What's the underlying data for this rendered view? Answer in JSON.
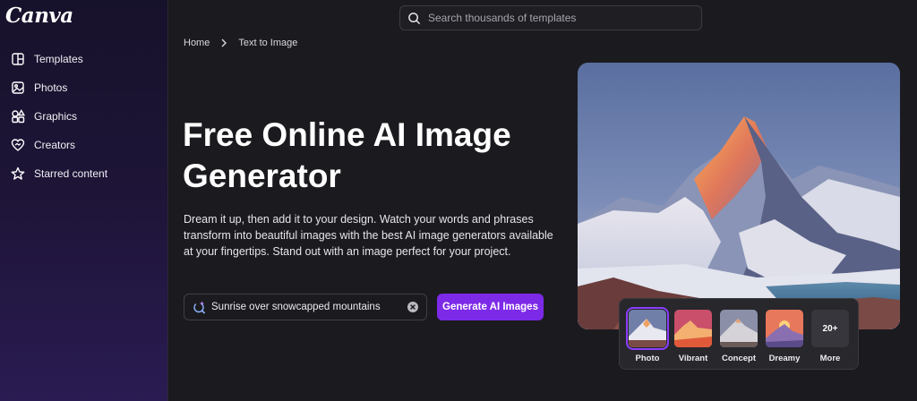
{
  "app": {
    "logo": "Canva"
  },
  "sidebar": {
    "items": [
      {
        "label": "Templates",
        "icon": "templates-icon"
      },
      {
        "label": "Photos",
        "icon": "photos-icon"
      },
      {
        "label": "Graphics",
        "icon": "graphics-icon"
      },
      {
        "label": "Creators",
        "icon": "creators-icon"
      },
      {
        "label": "Starred content",
        "icon": "star-icon"
      }
    ]
  },
  "search": {
    "placeholder": "Search thousands of templates"
  },
  "breadcrumb": {
    "home": "Home",
    "current": "Text to Image"
  },
  "hero": {
    "title": "Free Online AI Image Generator",
    "description": "Dream it up, then add it to your design. Watch your words and phrases transform into beautiful images with the best AI image generators available at your fingertips. Stand out with an image perfect for your project."
  },
  "prompt": {
    "value": "Sunrise over snowcapped mountains"
  },
  "generate_button": {
    "label": "Generate AI Images"
  },
  "styles": {
    "selected": "Photo",
    "options": [
      {
        "label": "Photo"
      },
      {
        "label": "Vibrant"
      },
      {
        "label": "Concept"
      },
      {
        "label": "Dreamy"
      },
      {
        "label": "More",
        "badge": "20+"
      }
    ]
  },
  "colors": {
    "accent": "#7d2ae8",
    "sidebar_bg": "#1d1436",
    "main_bg": "#1b1b1f"
  }
}
